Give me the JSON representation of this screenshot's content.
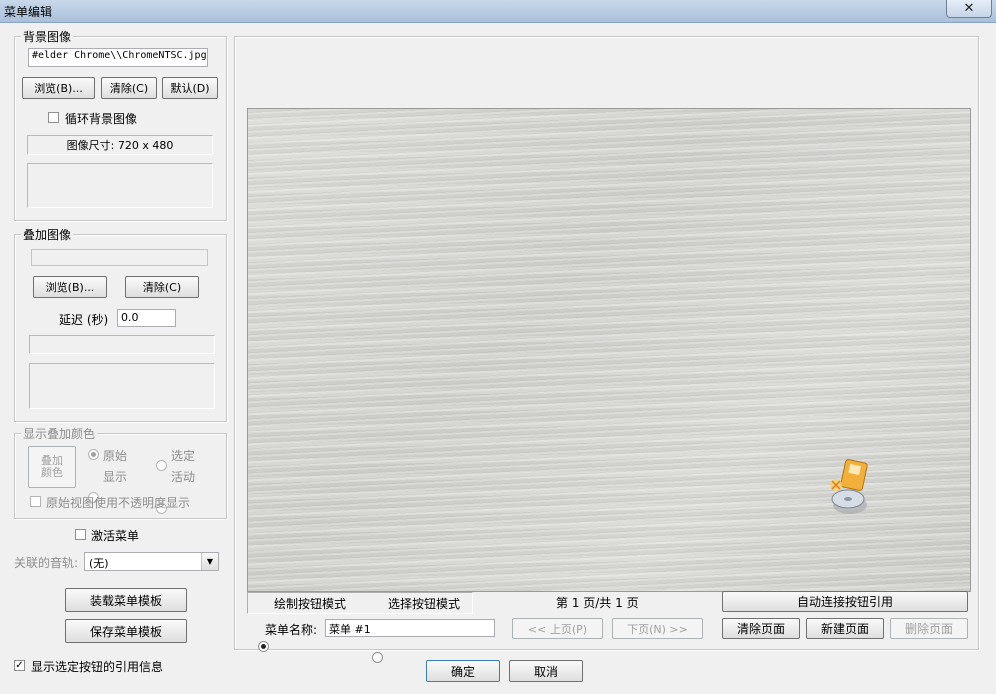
{
  "window": {
    "title": "菜单编辑",
    "close_glyph": "✕"
  },
  "background_group": {
    "legend": "背景图像",
    "file_path": "#elder Chrome\\\\ChromeNTSC.jpg",
    "browse_label": "浏览(B)...",
    "clear_label": "清除(C)",
    "default_label": "默认(D)",
    "loop_label": "循环背景图像",
    "loop_checked": false,
    "image_size": "图像尺寸: 720 x 480"
  },
  "overlay_group": {
    "legend": "叠加图像",
    "file_path": "",
    "browse_label": "浏览(B)...",
    "clear_label": "清除(C)",
    "delay_label": "延迟 (秒)",
    "delay_value": "0.0"
  },
  "color_group": {
    "legend": "显示叠加颜色",
    "overlay_color_button": "叠加\n颜色",
    "radio_original": "原始",
    "radio_selected": "选定",
    "radio_display": "显示",
    "radio_active": "活动",
    "opacity_label": "原始视图使用不透明度显示"
  },
  "activate_menu_label": "激活菜单",
  "audio_track": {
    "label": "关联的音轨:",
    "value": "(无)"
  },
  "load_template_label": "装载菜单模板",
  "save_template_label": "保存菜单模板",
  "show_ref_info_label": "显示选定按钮的引用信息",
  "show_ref_info_checked": true,
  "mode": {
    "draw_label": "绘制按钮模式",
    "select_label": "选择按钮模式",
    "selected": "draw"
  },
  "page_indicator": "第 1 页/共 1 页",
  "auto_link_label": "自动连接按钮引用",
  "menu_name": {
    "label": "菜单名称:",
    "value": "菜单 #1"
  },
  "prev_page_label": "<< 上页(P)",
  "next_page_label": "下页(N) >>",
  "clear_page_label": "清除页面",
  "new_page_label": "新建页面",
  "delete_page_label": "删除页面",
  "ok_label": "确定",
  "cancel_label": "取消",
  "colors": {
    "titlebar": "#aac0da",
    "dialog_bg": "#f0f0f0",
    "canvas": "#d4d4d0"
  },
  "icons": {
    "disc_wizard_icon": "disc-with-card-icon"
  }
}
